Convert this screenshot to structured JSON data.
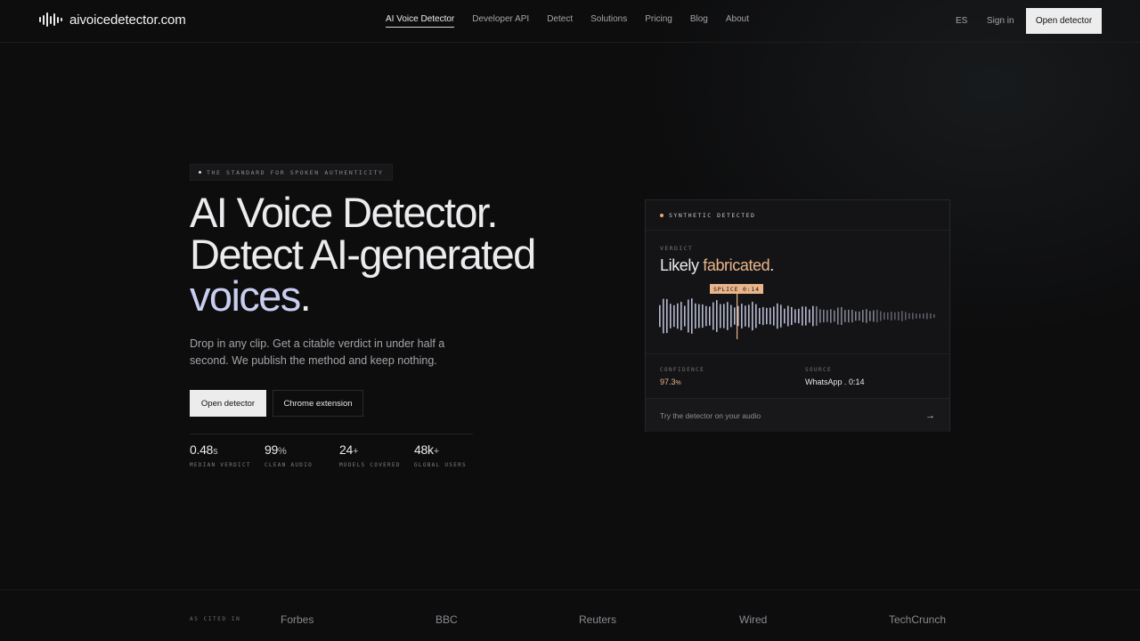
{
  "brand": {
    "name": "aivoicedetector.com"
  },
  "nav": {
    "links": [
      "AI Voice Detector",
      "Developer API",
      "Detect",
      "Solutions",
      "Pricing",
      "Blog",
      "About"
    ],
    "lang": "ES",
    "signin": "Sign in",
    "cta": "Open detector"
  },
  "hero": {
    "eyebrow": "THE STANDARD FOR SPOKEN AUTHENTICITY",
    "headline_line1": "AI Voice Detector.",
    "headline_line2": "Detect AI-generated",
    "headline_accent": "voices",
    "headline_period": ".",
    "subtitle": "Drop in any clip. Get a citable verdict in under half a second. We publish the method and keep nothing.",
    "primary_button": "Open detector",
    "secondary_button": "Chrome extension",
    "stats": [
      {
        "value": "0.48",
        "unit": "s",
        "label": "MEDIAN VERDICT"
      },
      {
        "value": "99",
        "unit": "%",
        "label": "CLEAN AUDIO"
      },
      {
        "value": "24",
        "unit": "+",
        "label": "MODELS COVERED"
      },
      {
        "value": "48k",
        "unit": "+",
        "label": "GLOBAL USERS"
      }
    ]
  },
  "card": {
    "status": "SYNTHETIC DETECTED",
    "verdict_label": "VERDICT",
    "verdict_prefix": "Likely ",
    "verdict_highlight": "fabricated",
    "verdict_suffix": ".",
    "splice_marker": "SPLICE 0:14",
    "confidence_label": "CONFIDENCE",
    "confidence_value": "97.3",
    "confidence_unit": "%",
    "source_label": "SOURCE",
    "source_value": "WhatsApp . 0:14",
    "footer_text": "Try the detector on your audio",
    "footer_arrow": "→",
    "colors": {
      "accent": "#eab58a",
      "status_dot": "#e8a977"
    }
  },
  "cited": {
    "label": "AS CITED IN",
    "publications": [
      "Forbes",
      "BBC",
      "Reuters",
      "Wired",
      "TechCrunch"
    ]
  }
}
